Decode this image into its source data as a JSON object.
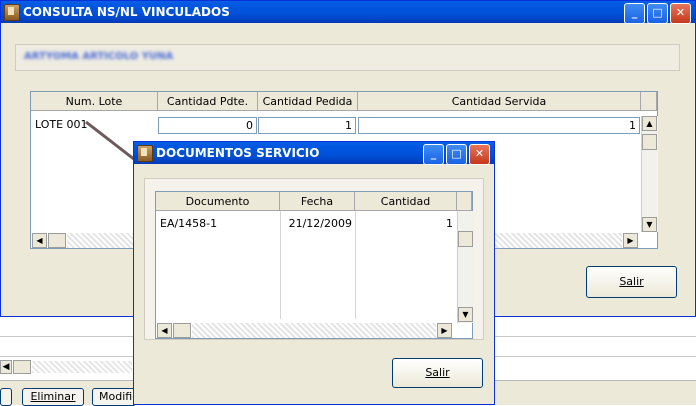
{
  "main_window": {
    "title": "CONSULTA NS/NL VINCULADOS",
    "article_label": "ARTYOMA ARTICOLO YUNA",
    "columns": [
      "Num. Lote",
      "Cantidad Pdte.",
      "Cantidad Pedida",
      "Cantidad Servida"
    ],
    "row": {
      "lote": "LOTE 001",
      "pdte": "0",
      "pedida": "1",
      "servida": "1"
    },
    "exit_button": "Salir"
  },
  "popup_window": {
    "title": "DOCUMENTOS SERVICIO",
    "columns": [
      "Documento",
      "Fecha",
      "Cantidad"
    ],
    "row": {
      "documento": "EA/1458-1",
      "fecha": "21/12/2009",
      "cantidad": "1"
    },
    "exit_button": "Salir"
  },
  "background_toolbar": {
    "delete_button": "Eliminar",
    "modify_button": "Modific"
  },
  "colors": {
    "title_bar": "#0054e3",
    "window_bg": "#ece9d8",
    "close_button": "#d8472a"
  }
}
